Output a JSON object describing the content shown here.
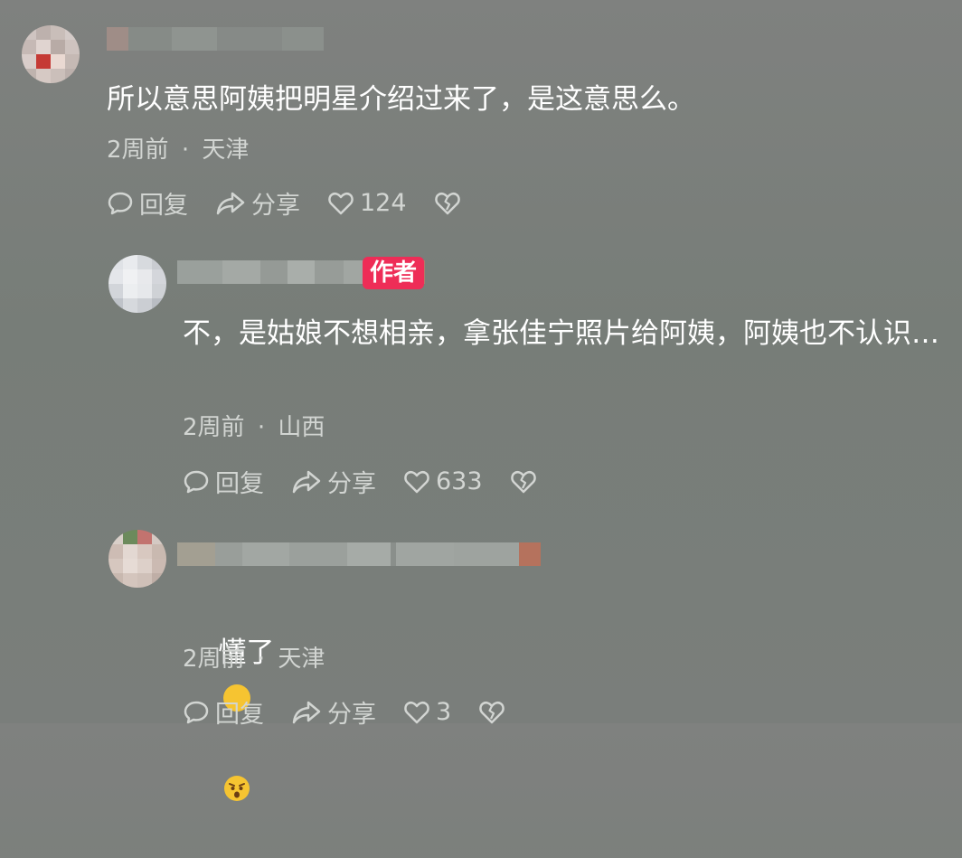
{
  "comments": [
    {
      "text": "所以意思阿姨把明星介绍过来了，是这意思么。",
      "time": "2周前",
      "location": "天津",
      "reply": "回复",
      "share": "分享",
      "likes": "124"
    },
    {
      "badge": "作者",
      "text": "不，是姑娘不想相亲，拿张佳宁照片给阿姨，阿姨也不认识…",
      "time": "2周前",
      "location": "山西",
      "reply": "回复",
      "share": "分享",
      "likes": "633"
    },
    {
      "text": "懂了",
      "emoji": "astonished-face",
      "time": "2周前",
      "location": "天津",
      "reply": "回复",
      "share": "分享",
      "likes": "3"
    }
  ],
  "separator": "·",
  "colors": {
    "author_badge": "#ee2d57",
    "text": "#ffffff",
    "meta": "#d2d5d2"
  }
}
